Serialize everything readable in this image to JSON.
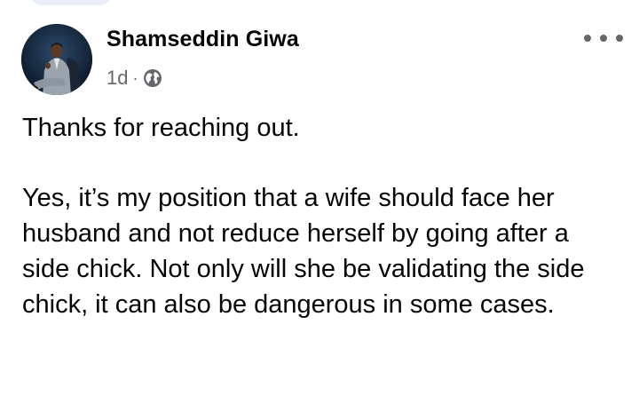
{
  "post": {
    "author": {
      "name": "Shamseddin Giwa",
      "avatar_icon": "profile-photo"
    },
    "meta": {
      "time": "1d",
      "separator": "·",
      "audience_icon": "globe-icon"
    },
    "more_icon": "more-horizontal-icon",
    "body": {
      "paragraphs": [
        "Thanks for reaching out.",
        "Yes, it’s my position that a wife should face her husband and not reduce herself by going after a side chick. Not only will she be validating the side chick, it can also be dangerous in some cases."
      ]
    }
  },
  "colors": {
    "name_text": "#050505",
    "meta_text": "#65676b",
    "background": "#ffffff"
  }
}
